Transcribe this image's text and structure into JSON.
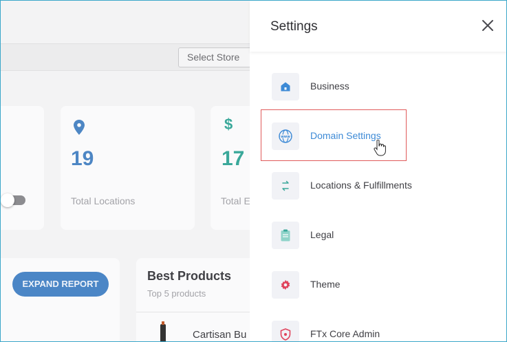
{
  "store_bar": {
    "select_store": "Select Store"
  },
  "stats": [
    {
      "value": "19",
      "label": "Total Locations"
    },
    {
      "value": "17",
      "label": "Total E"
    }
  ],
  "currency_symbol": "$",
  "report": {
    "expand_label": "EXPAND REPORT"
  },
  "best_products": {
    "title": "Best Products",
    "subtitle": "Top 5 products",
    "items": [
      "Cartisan Bu"
    ]
  },
  "settings": {
    "title": "Settings",
    "items": [
      {
        "label": "Business",
        "icon": "home-icon"
      },
      {
        "label": "Domain Settings",
        "icon": "globe-icon",
        "active": true
      },
      {
        "label": "Locations & Fulfillments",
        "icon": "swap-icon"
      },
      {
        "label": "Legal",
        "icon": "clipboard-icon"
      },
      {
        "label": "Theme",
        "icon": "gear-icon"
      },
      {
        "label": "FTx Core Admin",
        "icon": "shield-icon"
      }
    ]
  },
  "colors": {
    "accent": "#3d8ad6",
    "teal": "#3aa89a",
    "highlight_border": "#e05a5a",
    "theme_icon": "#e0435c"
  }
}
